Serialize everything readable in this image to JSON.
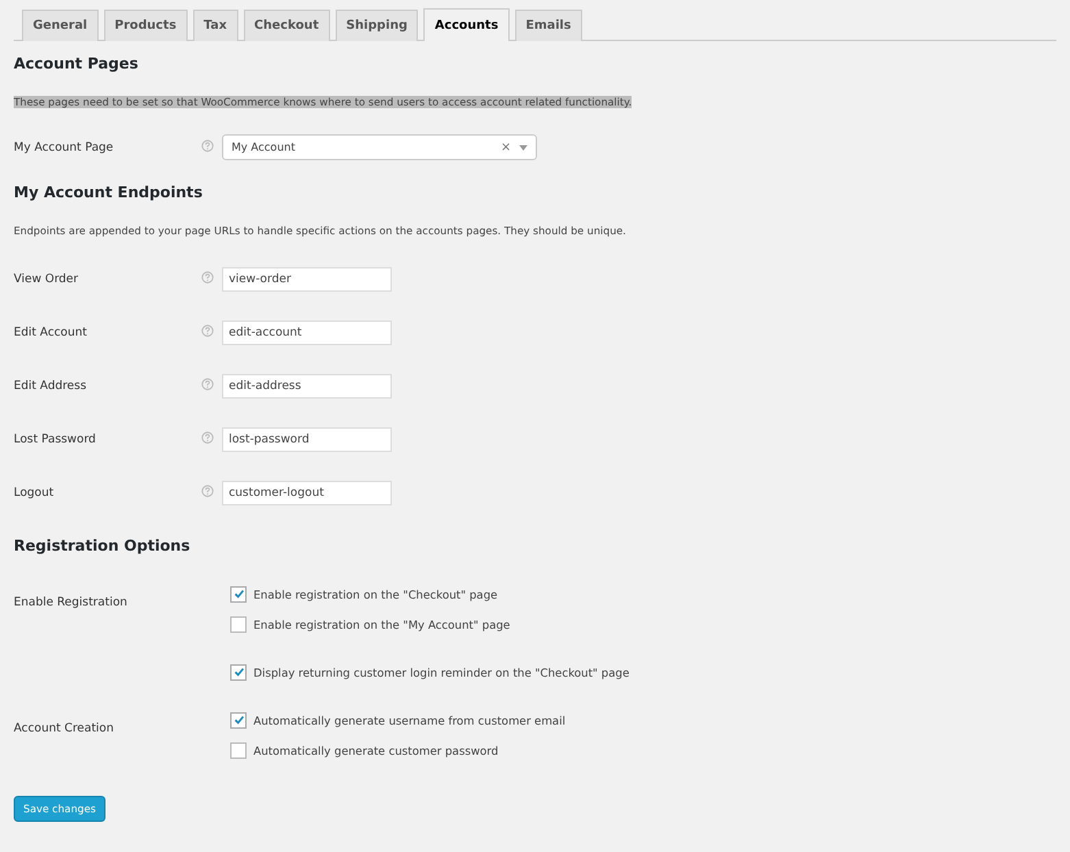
{
  "tabs": [
    {
      "label": "General",
      "selected": false
    },
    {
      "label": "Products",
      "selected": false
    },
    {
      "label": "Tax",
      "selected": false
    },
    {
      "label": "Checkout",
      "selected": false
    },
    {
      "label": "Shipping",
      "selected": false
    },
    {
      "label": "Accounts",
      "selected": true
    },
    {
      "label": "Emails",
      "selected": false
    }
  ],
  "account_pages": {
    "heading": "Account Pages",
    "description": "These pages need to be set so that WooCommerce knows where to send users to access account related functionality.",
    "field": {
      "label": "My Account Page",
      "value": "My Account",
      "clear": "×"
    }
  },
  "endpoints": {
    "heading": "My Account Endpoints",
    "description": "Endpoints are appended to your page URLs to handle specific actions on the accounts pages. They should be unique.",
    "fields": [
      {
        "label": "View Order",
        "value": "view-order"
      },
      {
        "label": "Edit Account",
        "value": "edit-account"
      },
      {
        "label": "Edit Address",
        "value": "edit-address"
      },
      {
        "label": "Lost Password",
        "value": "lost-password"
      },
      {
        "label": "Logout",
        "value": "customer-logout"
      }
    ]
  },
  "registration": {
    "heading": "Registration Options",
    "groups": [
      {
        "label": "Enable Registration",
        "options": [
          {
            "label": "Enable registration on the \"Checkout\" page",
            "checked": true
          },
          {
            "label": "Enable registration on the \"My Account\" page",
            "checked": false
          }
        ]
      },
      {
        "options": [
          {
            "label": "Display returning customer login reminder on the \"Checkout\" page",
            "checked": true
          }
        ]
      },
      {
        "label": "Account Creation",
        "options": [
          {
            "label": "Automatically generate username from customer email",
            "checked": true
          },
          {
            "label": "Automatically generate customer password",
            "checked": false
          }
        ]
      }
    ]
  },
  "save_button": "Save changes"
}
